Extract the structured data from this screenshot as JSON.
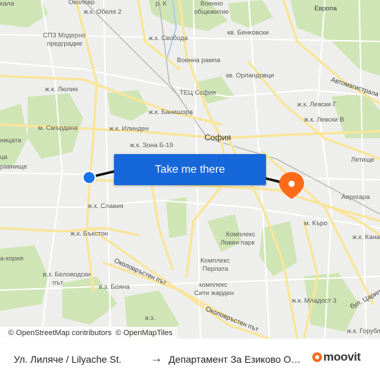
{
  "map": {
    "labels": {
      "obelya": "ж.к. Обеля 2",
      "vo": "Военно",
      "vo2": "общежитие",
      "spz1": "СПЗ Модерно",
      "spz2": "предградие",
      "svoboda": "ж.к. Свобода",
      "benkovski": "кв. Бенковски",
      "evropa": "Европа",
      "voenna": "Военна рампа",
      "orlandovtsi": "кв. Орландовци",
      "avtomagistrala": "Автомагистрала",
      "lyulin": "ж.к. Люлин",
      "tets": "ТЕЦ София",
      "banishora": "ж.к. Банишора",
      "levski_g": "ж.к. Левски Г",
      "levski_v": "ж.к. Левски В",
      "smardana": "м. Смърдана",
      "ilinden": "ж.к. Илинден",
      "sofia": "София",
      "zona": "ж.к. Зона Б-19",
      "letishte": "Летище",
      "aerogara": "Аерогара",
      "slavia": "ж.к. Славия",
      "karo": "м. Къро",
      "buxton": "ж.к. Бъкстон",
      "kompleks1": "Комплекс",
      "loven": "Ловен парк",
      "kana": "ж.к. Кана",
      "kompleks2": "Комплекс",
      "perlata": "Перлата",
      "beloved1": "в.з. Беловодски",
      "beloved2": "път",
      "boyana": "в.з. Бояна",
      "siti1": "комплекс",
      "siti2": "Сити жарден",
      "okolo1": "Околовръстен път",
      "okolo2": "Околовръстен път",
      "mladost": "ж.к. Младост 3",
      "tsarigr": "бул. Цариград",
      "gorubl": "ж.к. Горубл",
      "kala": "кала",
      "koriya": "а-кория",
      "nitsata": "ницата",
      "avnishte": "равнище",
      "tsa": "ца",
      "rk": "р. К",
      "okolo_top": "Околовр",
      "vz": "в.з."
    },
    "cta_label": "Take me there",
    "attribution": {
      "osm": "© OpenStreetMap contributors",
      "omt": "© OpenMapTiles"
    },
    "colors": {
      "background": "#eeefed",
      "park": "#cfe5b5",
      "road_major": "#f9e59a",
      "road_minor": "#ffffff",
      "route": "#111111",
      "origin": "#1a73e8",
      "destination": "#ff6a1a",
      "button": "#1667d9"
    }
  },
  "footer": {
    "from": "Ул. Лиляче / Lilyache St.",
    "arrow_icon": "arrow-right-icon",
    "to": "Департамент За Езиково Обучение",
    "brand": "moovit"
  }
}
